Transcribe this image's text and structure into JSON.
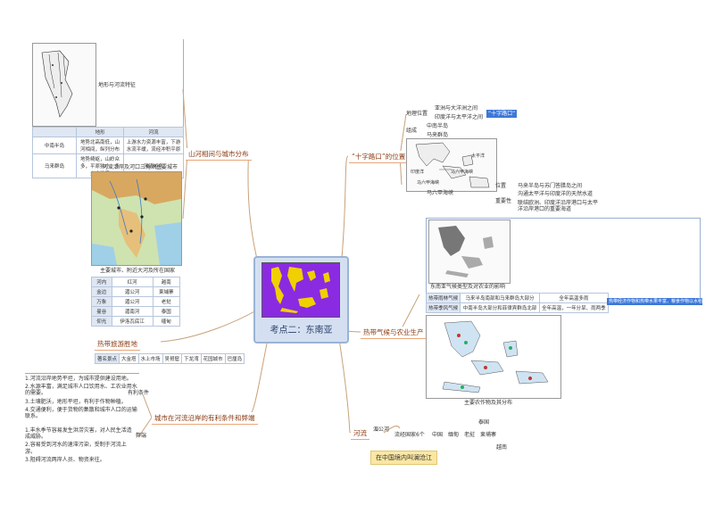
{
  "center": {
    "title": "考点二：东南亚"
  },
  "branches": {
    "rivers_cities": "山河相间与城市分布",
    "crossroads": "“十字路口”的位置",
    "climate_agri": "热带气候与农业生产",
    "advantages": "城市在河流沿岸的有利条件和弊端",
    "river": "河流"
  },
  "rivers_cities": {
    "map_caption": "地形与河流特征",
    "table1": {
      "header": [
        "",
        "地形",
        "河流"
      ],
      "rows": [
        [
          "中南半岛",
          "地势北高南低，山河相间，纵列分布",
          "上游水力资源丰富，下游水流平缓，流经冲积平原"
        ],
        [
          "马来群岛",
          "地势崎岖，山岭众多，平原狭小，多火山地震",
          "河流短急"
        ]
      ]
    },
    "delta_caption": "河流沿岸及河口三角洲",
    "capital_caption": "主要城市",
    "cities_caption": "主要城市、附近大河及所在国家",
    "table2": {
      "rows": [
        [
          "河内",
          "红河",
          "越南"
        ],
        [
          "金边",
          "湄公河",
          "柬埔寨"
        ],
        [
          "万象",
          "湄公河",
          "老挝"
        ],
        [
          "曼谷",
          "湄南河",
          "泰国"
        ],
        [
          "仰光",
          "伊洛瓦底江",
          "缅甸"
        ]
      ]
    }
  },
  "tourism": {
    "title": "热带旅游胜地",
    "items": [
      "著名景点",
      "大金塔",
      "水上市场",
      "吴哥窟",
      "下龙湾",
      "花园城市",
      "巴厘岛"
    ]
  },
  "advantages": {
    "favorable_label": "有利条件",
    "favorable": [
      "1.河流沿岸地势平坦，为城市提供建设用地。",
      "2.水源丰富，满足城市人口饮用水、工农业用水的需要。",
      "3.土壤肥沃，地形平坦，有利于作物种植。",
      "4.交通便利，便于货物的集散和城市人口的运输联系。"
    ],
    "drawback_label": "弊端",
    "drawbacks": [
      "1.丰水季节容易发生洪涝灾害，对人民生活造成威胁。",
      "2.容易受到河水的速滞污染，受制于河流上游。",
      "3.阻碍河流两岸人员、物资来往。"
    ]
  },
  "crossroads": {
    "geo_label": "地理位置",
    "geo_items": [
      "亚洲与大洋洲之间",
      "印度洋与太平洋之间"
    ],
    "geo_tag": "“十字路口”",
    "compose_label": "组成",
    "compose_items": [
      "中南半岛",
      "马来群岛"
    ],
    "map_labels": [
      "印度洋",
      "太平洋",
      "马六甲海峡",
      "马六甲海峡"
    ],
    "strait_label": "马六甲海峡",
    "location_label": "位置",
    "location_text": "马来半岛与苏门答腊岛之间",
    "importance_label": "重要性",
    "importance_items": [
      "沟通太平洋与印度洋的天然水道",
      "联结欧洲、印度洋沿岸港口与太平洋沿岸港口的重要海道"
    ]
  },
  "climate_agri": {
    "map_caption": "东南亚气候类型及对农业的影响",
    "table": {
      "rows": [
        [
          "热带雨林气候",
          "马来半岛南部和马来群岛大部分",
          "全年高温多雨"
        ],
        [
          "热带季风气候",
          "中南半岛大部分和菲律宾群岛北部",
          "全年高温，一年分旱、雨两季"
        ]
      ]
    },
    "effect_tag": "热带经济作物和热带水果丰富，粮食作物以水稻为主",
    "crops_caption": "主要农作物及其分布"
  },
  "river": {
    "mekong": "湄公河",
    "flow": [
      "流经国家6个",
      "中国",
      "缅甸",
      "老挝",
      "泰国",
      "柬埔寨",
      "越南"
    ],
    "china_tag": "在中国境内叫澜沧江"
  },
  "colors": {
    "line": "#c8a27a",
    "accent": "#3c78d8",
    "center_bg": "#d4e0f2",
    "orange": "#e9a67a",
    "yellow": "#fbe7a3"
  }
}
